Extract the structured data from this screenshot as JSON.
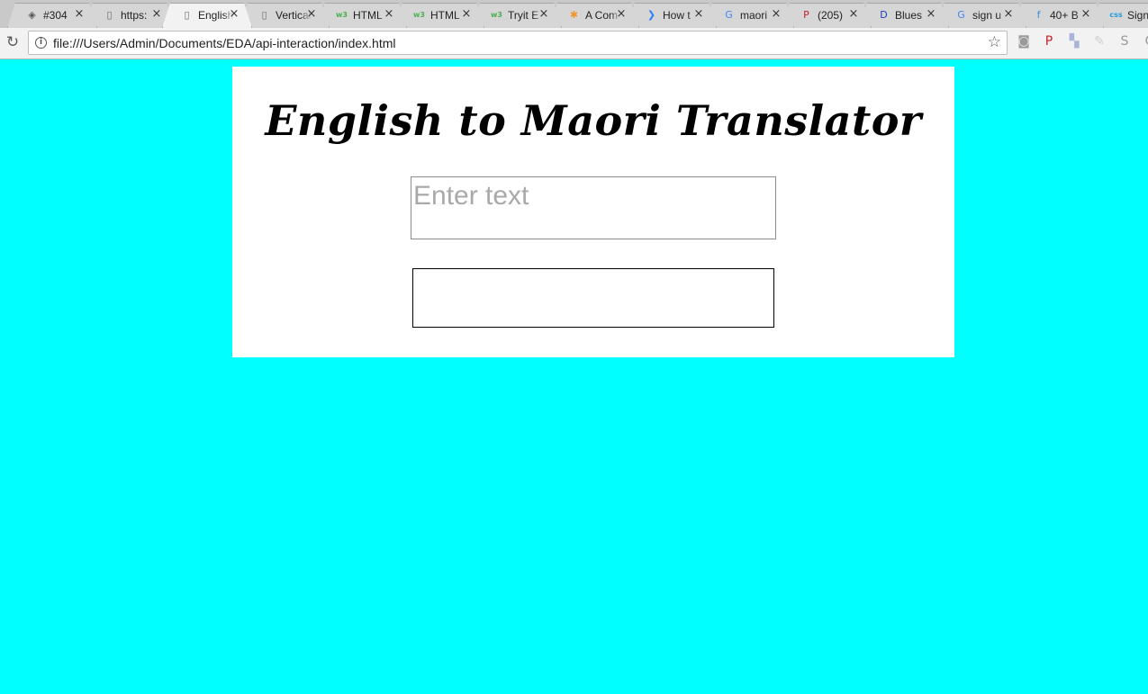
{
  "browser": {
    "tabs": [
      {
        "title": "#304",
        "icon": "diamond-icon",
        "glyph": "◈",
        "color": "#555555"
      },
      {
        "title": "https:",
        "icon": "page-icon",
        "glyph": "▯",
        "color": "#666666"
      },
      {
        "title": "English",
        "icon": "page-icon",
        "glyph": "▯",
        "color": "#666666",
        "active": true
      },
      {
        "title": "Vertical",
        "icon": "page-icon",
        "glyph": "▯",
        "color": "#666666"
      },
      {
        "title": "HTML",
        "icon": "w3schools-icon",
        "glyph": "w3",
        "color": "#4caf50"
      },
      {
        "title": "HTML",
        "icon": "w3schools-icon",
        "glyph": "w3",
        "color": "#4caf50"
      },
      {
        "title": "Tryit E",
        "icon": "w3schools-icon",
        "glyph": "w3",
        "color": "#4caf50"
      },
      {
        "title": "A Com",
        "icon": "asterisk-icon",
        "glyph": "✱",
        "color": "#f0932b"
      },
      {
        "title": "How t",
        "icon": "arrows-icon",
        "glyph": "❯",
        "color": "#2d7ff9"
      },
      {
        "title": "maori",
        "icon": "google-icon",
        "glyph": "G",
        "color": "#4285f4"
      },
      {
        "title": "(205)",
        "icon": "pinterest-icon",
        "glyph": "P",
        "color": "#cb2027"
      },
      {
        "title": "Blues",
        "icon": "d-logo-icon",
        "glyph": "D",
        "color": "#1a3fbf"
      },
      {
        "title": "sign u",
        "icon": "google-icon",
        "glyph": "G",
        "color": "#4285f4"
      },
      {
        "title": "40+ B",
        "icon": "f-logo-icon",
        "glyph": "f",
        "color": "#3b8fd9"
      },
      {
        "title": "Sign",
        "icon": "css-icon",
        "glyph": "css",
        "color": "#1e9be0"
      }
    ],
    "close_glyph": "×",
    "url": "file:///Users/Admin/Documents/EDA/api-interaction/index.html",
    "reload_glyph": "↻",
    "info_glyph": "i",
    "star_glyph": "☆",
    "extensions": [
      {
        "icon": "camera-icon",
        "glyph": "◙",
        "color": "#9a9a9a"
      },
      {
        "icon": "pinterest-icon",
        "glyph": "P",
        "color": "#cb2027"
      },
      {
        "icon": "puzzle-icon",
        "glyph": "▚",
        "color": "#a8b4d8"
      },
      {
        "icon": "feather-icon",
        "glyph": "✎",
        "color": "#cfcfcf"
      },
      {
        "icon": "skype-icon",
        "glyph": "S",
        "color": "#9a9a9a"
      },
      {
        "icon": "circle-icon",
        "glyph": "G",
        "color": "#9a9a9a"
      }
    ]
  },
  "page": {
    "background": "#00ffff",
    "title": "English to Maori Translator",
    "input": {
      "placeholder": "Enter text",
      "value": ""
    },
    "output": ""
  }
}
